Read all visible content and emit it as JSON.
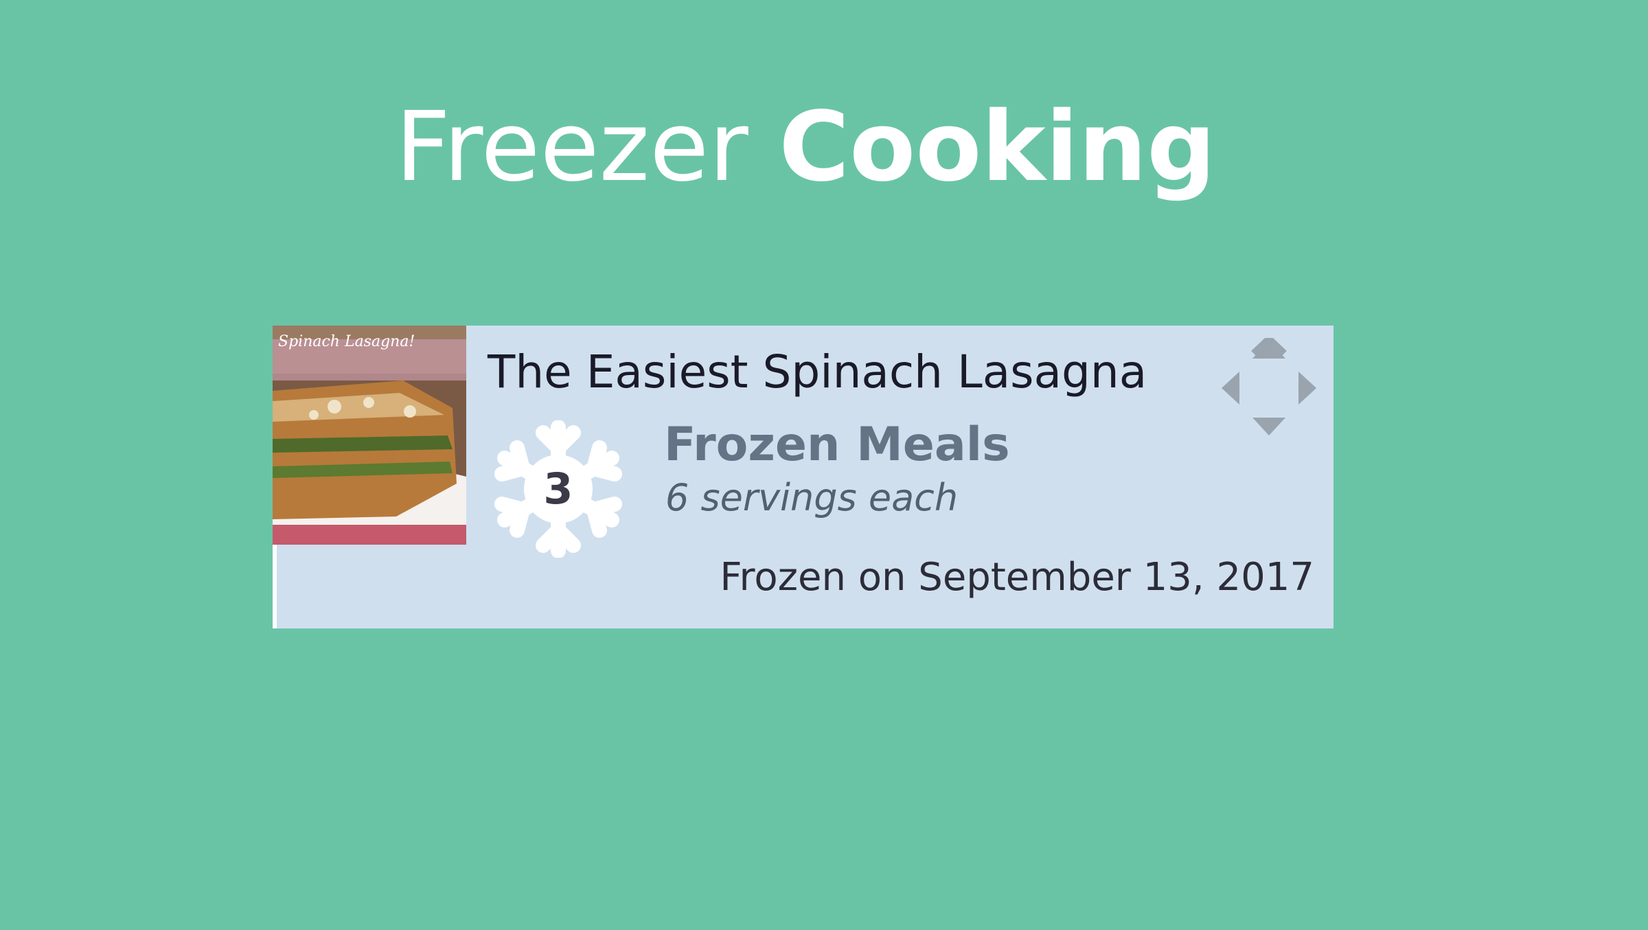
{
  "header": {
    "title_light": "Freezer",
    "title_bold": "Cooking"
  },
  "card": {
    "recipe_name": "The Easiest Spinach Lasagna",
    "thumbnail_caption": "Spinach Lasagna!",
    "freezer_count": "3",
    "category": "Frozen Meals",
    "servings": "6 servings each",
    "frozen_date": "Frozen on September 13, 2017",
    "icons": {
      "snowflake": "snowflake-icon",
      "move": "move-arrows-icon"
    }
  },
  "colors": {
    "background": "#69c4a6",
    "card_background": "#cfdfee",
    "category_text": "#657386",
    "move_icon": "#9aa4ae"
  }
}
